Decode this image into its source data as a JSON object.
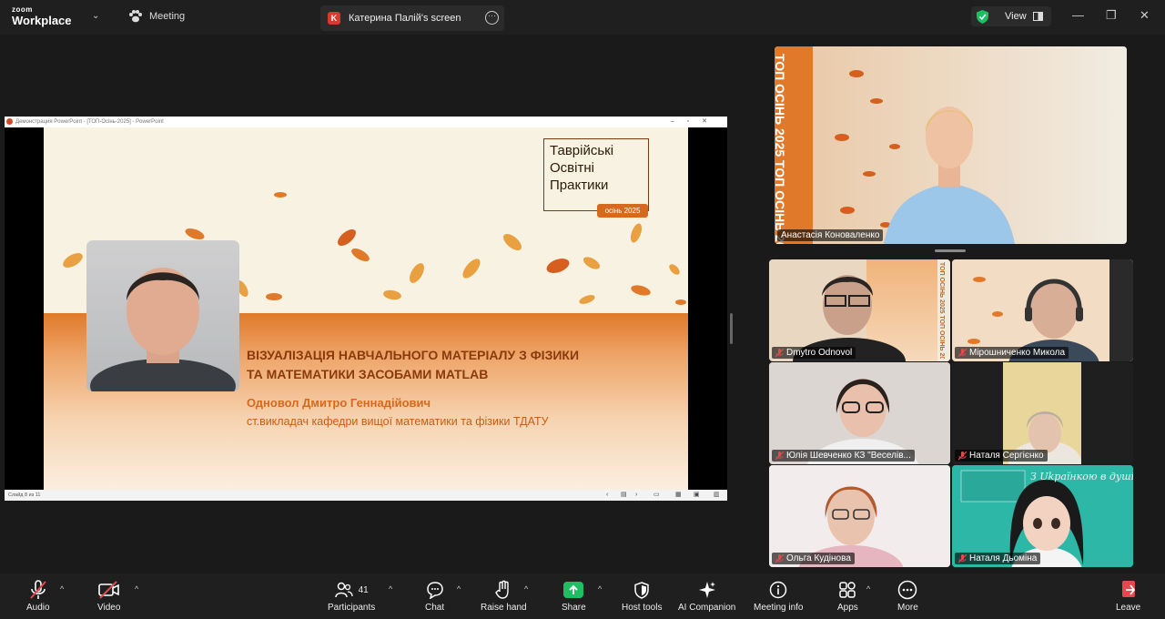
{
  "app": {
    "logo_line1": "zoom",
    "logo_line2": "Workplace",
    "meeting_tab": "Meeting",
    "share_tab": "Катерина Палій's screen",
    "share_tab_badge": "K",
    "view_label": "View"
  },
  "presentation": {
    "window_title": "Демонстрация PowerPoint - [ТОП-Осінь-2025] - PowerPoint",
    "status_text": "Слайд 8 из 11",
    "brand_lines": [
      "Таврійські",
      "Освітні",
      "Практики"
    ],
    "brand_badge": "осінь 2025",
    "title_line1": "ВІЗУАЛІЗАЦІЯ НАВЧАЛЬНОГО МАТЕРІАЛУ З ФІЗИКИ",
    "title_line2": "ТА МАТЕМАТИКИ ЗАСОБАМИ MATLAB",
    "author": "Одновол Дмитро Геннадійович",
    "position": "ст.викладач кафедри вищої математики та фізики ТДАТУ"
  },
  "featured": {
    "name": "Анастасія Коноваленко",
    "banner_text": "ТОП ОСІНЬ 2025 ТОП ОСІНЬ 2025"
  },
  "participants": [
    {
      "name": "Dmytro Odnovol",
      "muted": true
    },
    {
      "name": "Мірошниченко Микола",
      "muted": true
    },
    {
      "name": "Юлія Шевченко КЗ \"Веселів...",
      "muted": true
    },
    {
      "name": "Наталя Сергієнко",
      "muted": true
    },
    {
      "name": "Ольга Кудінова",
      "muted": true
    },
    {
      "name": "Наталя Дьоміна",
      "muted": true
    }
  ],
  "tile_text": {
    "dmytro_banner": "ТОП ОСІНЬ 2025 ТОП ОСІНЬ 2025",
    "dyomina_script": "З Ukрaїнкою в душі"
  },
  "toolbar": {
    "audio": "Audio",
    "video": "Video",
    "participants": "Participants",
    "participants_count": "41",
    "chat": "Chat",
    "raise_hand": "Raise hand",
    "share": "Share",
    "host_tools": "Host tools",
    "ai_companion": "AI Companion",
    "meeting_info": "Meeting info",
    "apps": "Apps",
    "more": "More",
    "leave": "Leave"
  },
  "colors": {
    "accent_green": "#1dbf62",
    "muted_red": "#e5484d",
    "slide_orange": "#d6691e"
  }
}
